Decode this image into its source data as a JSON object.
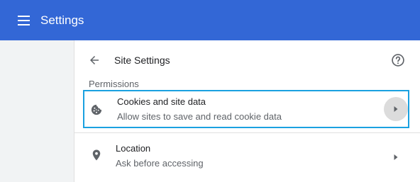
{
  "app": {
    "title": "Settings"
  },
  "header": {
    "title": "Site Settings"
  },
  "section": {
    "label": "Permissions"
  },
  "rows": [
    {
      "title": "Cookies and site data",
      "subtitle": "Allow sites to save and read cookie data",
      "icon": "cookie-icon"
    },
    {
      "title": "Location",
      "subtitle": "Ask before accessing",
      "icon": "location-pin-icon"
    }
  ],
  "colors": {
    "topbar": "#3367d6",
    "highlight_border": "#1aa1e0"
  }
}
